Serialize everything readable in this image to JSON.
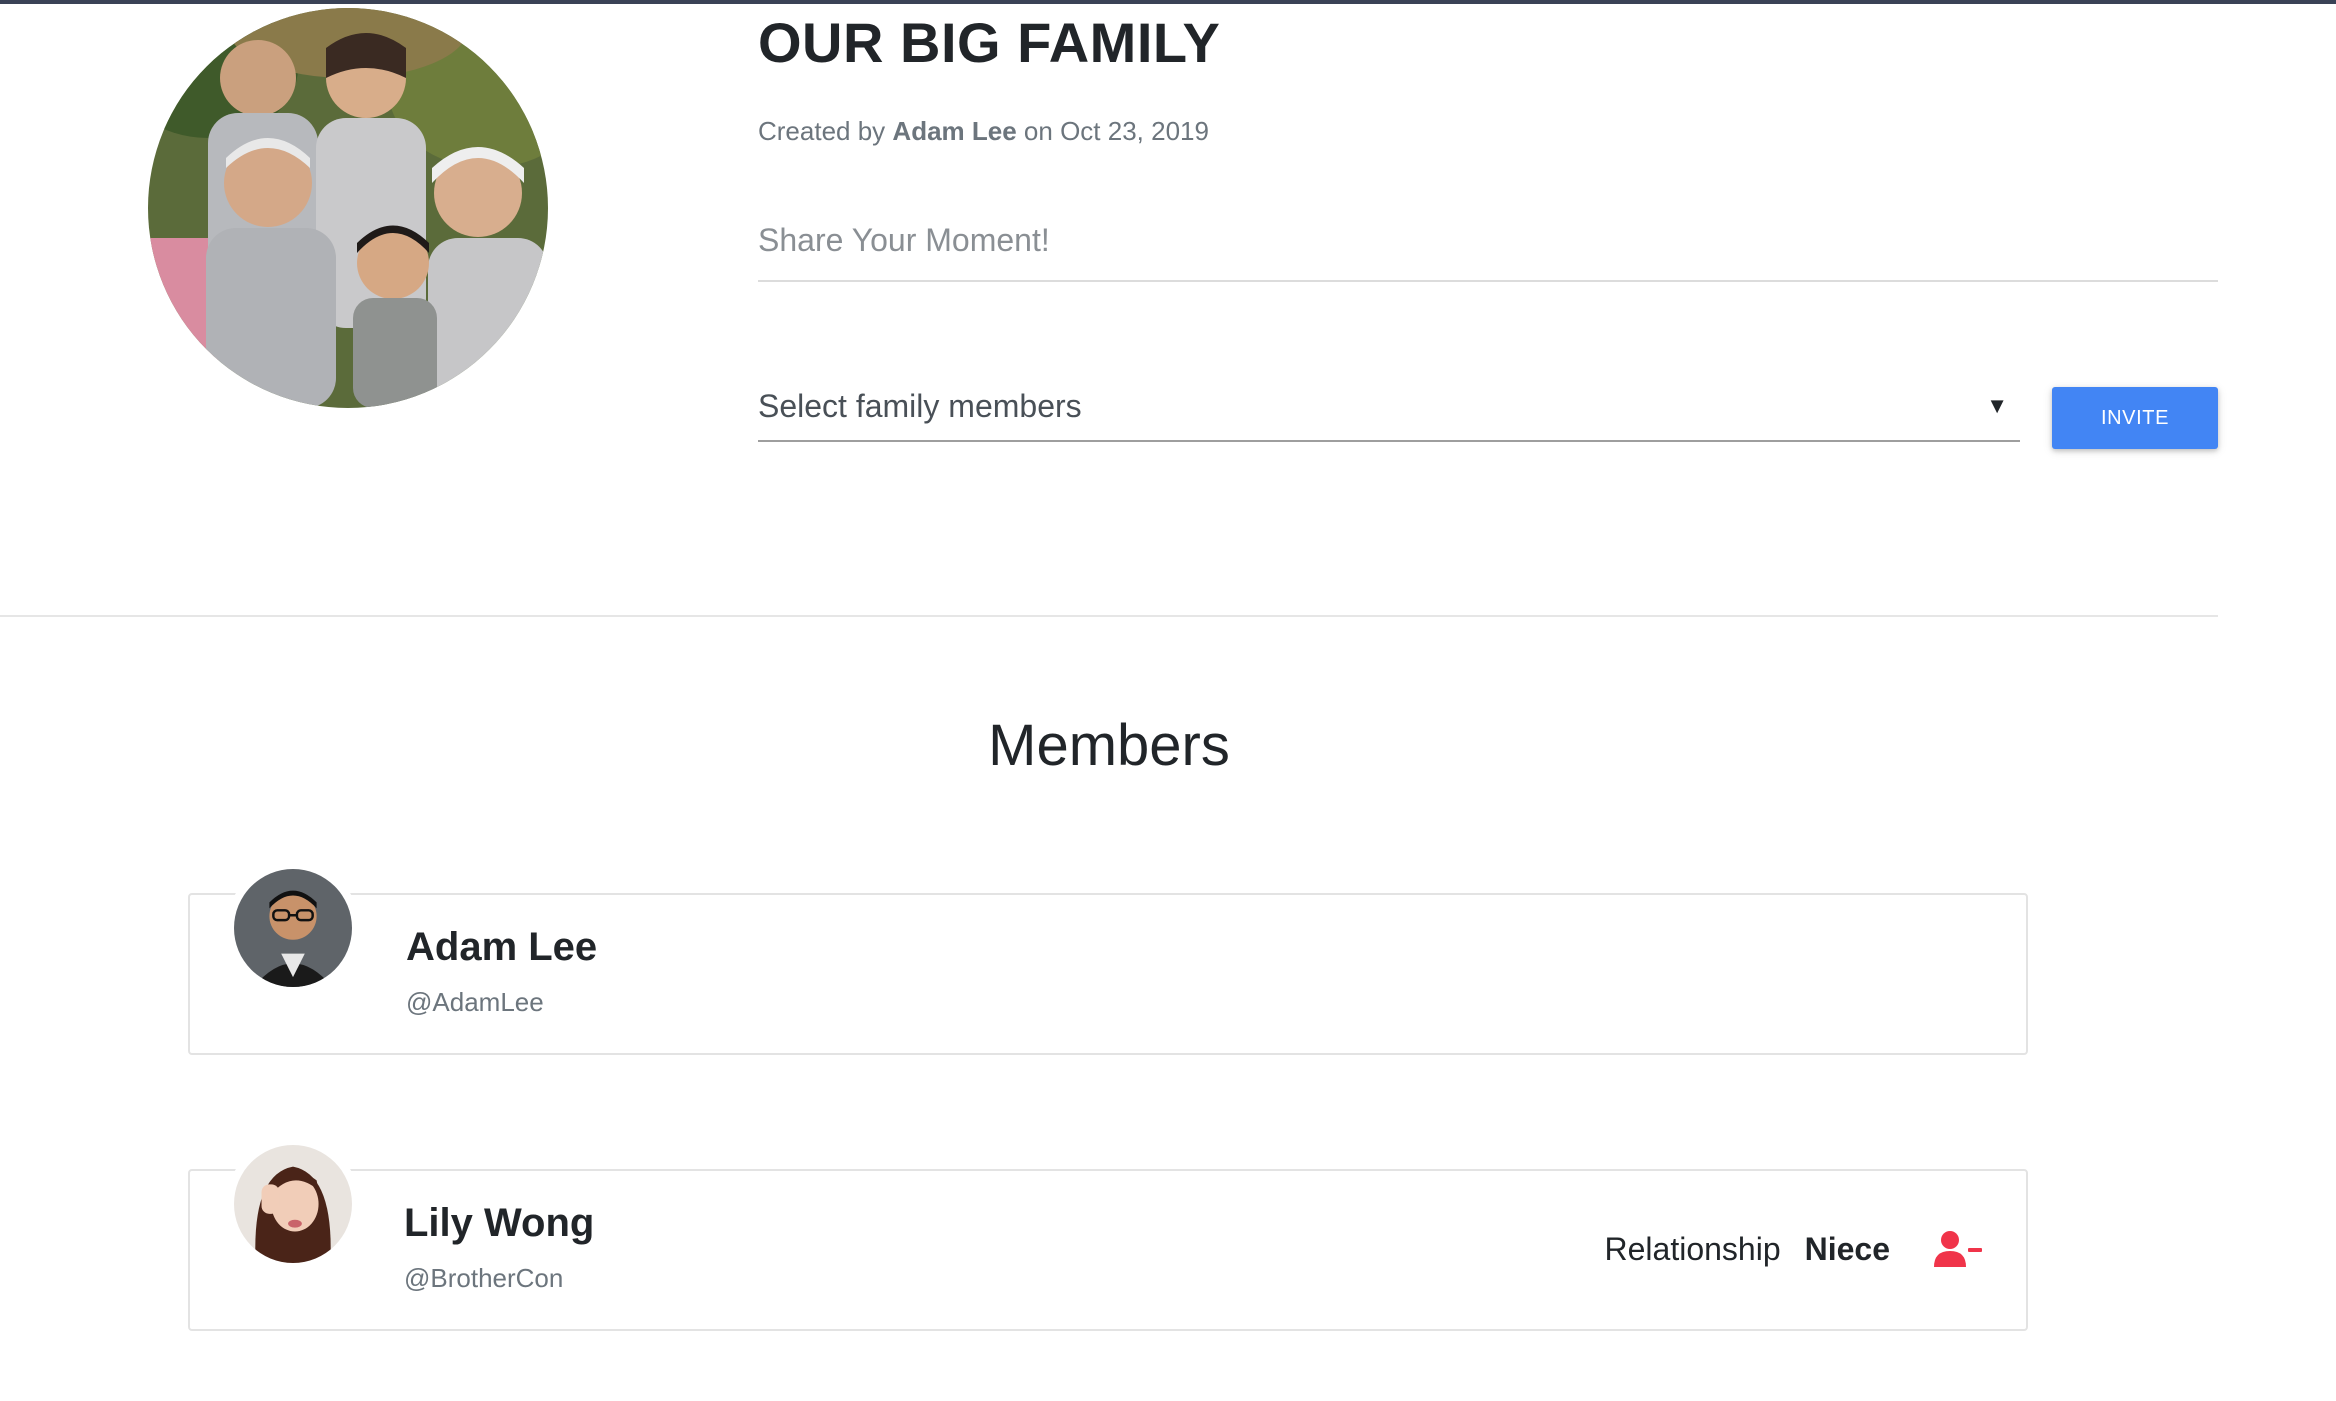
{
  "group": {
    "title": "OUR BIG FAMILY",
    "created_prefix": "Created by",
    "creator": "Adam Lee",
    "created_mid": "on",
    "created_date": "Oct 23, 2019"
  },
  "share": {
    "placeholder": "Share Your Moment!"
  },
  "invite": {
    "select_value": "Select family members",
    "caret": "▼",
    "button_label": "INVITE"
  },
  "members": {
    "heading": "Members",
    "items": [
      {
        "name": "Adam Lee",
        "handle": "@AdamLee"
      },
      {
        "name": "Lily Wong",
        "handle": "@BrotherCon",
        "relationship_label": "Relationship",
        "relationship": "Niece"
      }
    ]
  },
  "icons": {
    "remove": "user-minus-icon"
  },
  "colors": {
    "primary": "#4285f4",
    "danger": "#f0344a",
    "text": "#212529",
    "muted": "#6c757d"
  }
}
